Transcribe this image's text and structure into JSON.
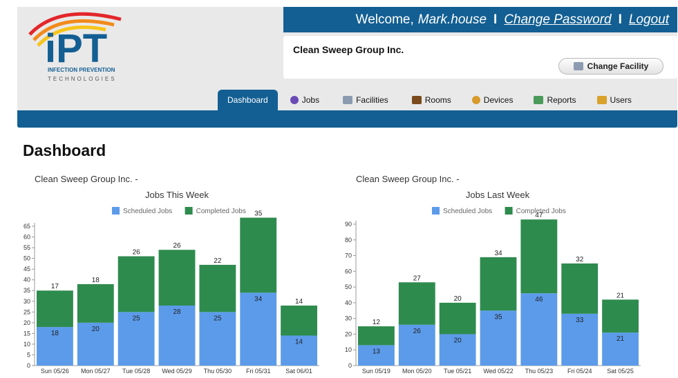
{
  "header": {
    "welcome_label": "Welcome,",
    "username": "Mark.house",
    "separator": "I",
    "change_password": "Change Password",
    "logout": "Logout"
  },
  "logo": {
    "wordmark": "iPT",
    "line1": "INFECTION PREVENTION",
    "line2": "TECHNOLOGIES"
  },
  "facility": {
    "name": "Clean Sweep Group Inc.",
    "change_button": "Change Facility"
  },
  "nav": [
    {
      "label": "Dashboard",
      "icon": "",
      "active": true
    },
    {
      "label": "Jobs",
      "icon": "jobs-icon",
      "color": "#6a4bb5"
    },
    {
      "label": "Facilities",
      "icon": "facilities-icon",
      "color": "#8c9bb0"
    },
    {
      "label": "Rooms",
      "icon": "rooms-icon",
      "color": "#7a4a1c"
    },
    {
      "label": "Devices",
      "icon": "devices-icon",
      "color": "#d89a2b"
    },
    {
      "label": "Reports",
      "icon": "reports-icon",
      "color": "#4a9a5a"
    },
    {
      "label": "Users",
      "icon": "users-icon",
      "color": "#d9a22b"
    }
  ],
  "page_title": "Dashboard",
  "colors": {
    "brand": "#135f93",
    "scheduled": "#5b9bea",
    "completed": "#2e8b4e"
  },
  "chart_data": [
    {
      "type": "bar",
      "subtitle": "Clean Sweep Group Inc. -",
      "title": "Jobs This Week",
      "legend": [
        "Scheduled Jobs",
        "Completed Jobs"
      ],
      "categories": [
        "Sun 05/26",
        "Mon 05/27",
        "Tue 05/28",
        "Wed 05/29",
        "Thu 05/30",
        "Fri 05/31",
        "Sat 06/01"
      ],
      "series": [
        {
          "name": "Scheduled Jobs",
          "values": [
            18,
            20,
            25,
            28,
            25,
            34,
            14
          ]
        },
        {
          "name": "Completed Jobs",
          "values": [
            17,
            18,
            26,
            26,
            22,
            35,
            14
          ]
        }
      ],
      "ylim": [
        0,
        65
      ],
      "yticks": [
        0,
        5,
        10,
        15,
        20,
        25,
        30,
        35,
        40,
        45,
        50,
        55,
        60,
        65
      ]
    },
    {
      "type": "bar",
      "subtitle": "Clean Sweep Group Inc. -",
      "title": "Jobs Last Week",
      "legend": [
        "Scheduled Jobs",
        "Completed Jobs"
      ],
      "categories": [
        "Sun 05/19",
        "Mon 05/20",
        "Tue 05/21",
        "Wed 05/22",
        "Thu 05/23",
        "Fri 05/24",
        "Sat 05/25"
      ],
      "series": [
        {
          "name": "Scheduled Jobs",
          "values": [
            13,
            26,
            20,
            35,
            46,
            33,
            21
          ]
        },
        {
          "name": "Completed Jobs",
          "values": [
            12,
            27,
            20,
            34,
            47,
            32,
            21
          ]
        }
      ],
      "ylim": [
        0,
        90
      ],
      "yticks": [
        0,
        10,
        20,
        30,
        40,
        50,
        60,
        70,
        80,
        90
      ]
    }
  ]
}
